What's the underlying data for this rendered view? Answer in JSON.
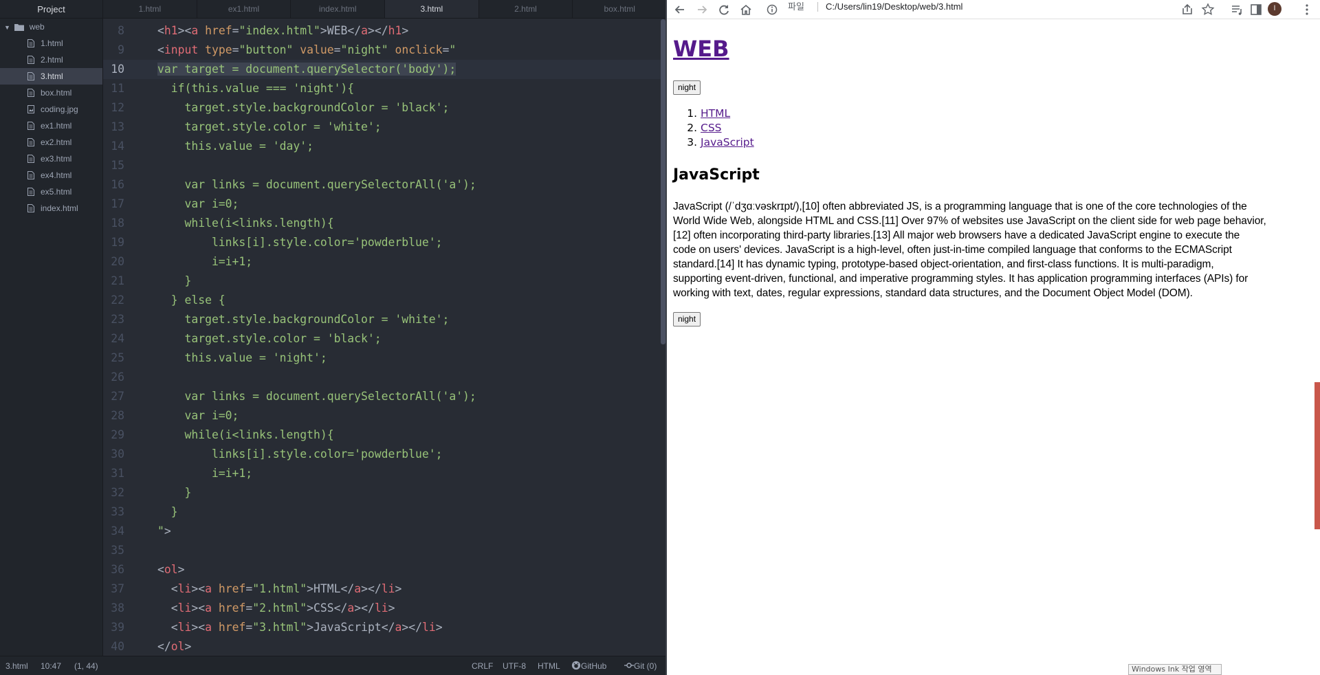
{
  "tree": {
    "header": "Project",
    "root": "web",
    "files": [
      {
        "name": "1.html",
        "icon": "file-text-icon"
      },
      {
        "name": "2.html",
        "icon": "file-text-icon"
      },
      {
        "name": "3.html",
        "icon": "file-text-icon",
        "selected": true
      },
      {
        "name": "box.html",
        "icon": "file-text-icon"
      },
      {
        "name": "coding.jpg",
        "icon": "image-file-icon"
      },
      {
        "name": "ex1.html",
        "icon": "file-text-icon"
      },
      {
        "name": "ex2.html",
        "icon": "file-text-icon"
      },
      {
        "name": "ex3.html",
        "icon": "file-text-icon"
      },
      {
        "name": "ex4.html",
        "icon": "file-text-icon"
      },
      {
        "name": "ex5.html",
        "icon": "file-text-icon"
      },
      {
        "name": "index.html",
        "icon": "file-text-icon"
      }
    ]
  },
  "tabs": [
    {
      "label": "1.html"
    },
    {
      "label": "ex1.html"
    },
    {
      "label": "index.html"
    },
    {
      "label": "3.html",
      "active": true
    },
    {
      "label": "2.html"
    },
    {
      "label": "box.html"
    }
  ],
  "code": {
    "current_line": 10,
    "lines": [
      {
        "n": "8",
        "html": "<span class=\"p\">&lt;</span><span class=\"t\">h1</span><span class=\"p\">&gt;&lt;</span><span class=\"t\">a</span> <span class=\"a\">href</span><span class=\"p\">=</span><span class=\"s\">\"index.html\"</span><span class=\"p\">&gt;WEB&lt;/</span><span class=\"t\">a</span><span class=\"p\">&gt;&lt;/</span><span class=\"t\">h1</span><span class=\"p\">&gt;</span>"
      },
      {
        "n": "9",
        "html": "<span class=\"p\">&lt;</span><span class=\"t\">input</span> <span class=\"a\">type</span><span class=\"p\">=</span><span class=\"s\">\"button\"</span> <span class=\"a\">value</span><span class=\"p\">=</span><span class=\"s\">\"night\"</span> <span class=\"a\">onclick</span><span class=\"p\">=</span><span class=\"s\">\"</span>"
      },
      {
        "n": "10",
        "html": "<span class=\"hl\"><span class=\"s\">var target = document.querySelector('body');</span></span>"
      },
      {
        "n": "11",
        "html": "<span class=\"s\">  if(this.value === 'night'){</span>"
      },
      {
        "n": "12",
        "html": "<span class=\"s\">    target.style.backgroundColor = 'black';</span>"
      },
      {
        "n": "13",
        "html": "<span class=\"s\">    target.style.color = 'white';</span>"
      },
      {
        "n": "14",
        "html": "<span class=\"s\">    this.value = 'day';</span>"
      },
      {
        "n": "15",
        "html": ""
      },
      {
        "n": "16",
        "html": "<span class=\"s\">    var links = document.querySelectorAll('a');</span>"
      },
      {
        "n": "17",
        "html": "<span class=\"s\">    var i=0;</span>"
      },
      {
        "n": "18",
        "html": "<span class=\"s\">    while(i&lt;links.length){</span>"
      },
      {
        "n": "19",
        "html": "<span class=\"s\">        links[i].style.color='powderblue';</span>"
      },
      {
        "n": "20",
        "html": "<span class=\"s\">        i=i+1;</span>"
      },
      {
        "n": "21",
        "html": "<span class=\"s\">    }</span>"
      },
      {
        "n": "22",
        "html": "<span class=\"s\">  } else {</span>"
      },
      {
        "n": "23",
        "html": "<span class=\"s\">    target.style.backgroundColor = 'white';</span>"
      },
      {
        "n": "24",
        "html": "<span class=\"s\">    target.style.color = 'black';</span>"
      },
      {
        "n": "25",
        "html": "<span class=\"s\">    this.value = 'night';</span>"
      },
      {
        "n": "26",
        "html": ""
      },
      {
        "n": "27",
        "html": "<span class=\"s\">    var links = document.querySelectorAll('a');</span>"
      },
      {
        "n": "28",
        "html": "<span class=\"s\">    var i=0;</span>"
      },
      {
        "n": "29",
        "html": "<span class=\"s\">    while(i&lt;links.length){</span>"
      },
      {
        "n": "30",
        "html": "<span class=\"s\">        links[i].style.color='powderblue';</span>"
      },
      {
        "n": "31",
        "html": "<span class=\"s\">        i=i+1;</span>"
      },
      {
        "n": "32",
        "html": "<span class=\"s\">    }</span>"
      },
      {
        "n": "33",
        "html": "<span class=\"s\">  }</span>"
      },
      {
        "n": "34",
        "html": "<span class=\"s\">\"</span><span class=\"p\">&gt;</span>"
      },
      {
        "n": "35",
        "html": ""
      },
      {
        "n": "36",
        "html": "<span class=\"p\">&lt;</span><span class=\"t\">ol</span><span class=\"p\">&gt;</span>"
      },
      {
        "n": "37",
        "html": "<span class=\"p\">  &lt;</span><span class=\"t\">li</span><span class=\"p\">&gt;&lt;</span><span class=\"t\">a</span> <span class=\"a\">href</span><span class=\"p\">=</span><span class=\"s\">\"1.html\"</span><span class=\"p\">&gt;HTML&lt;/</span><span class=\"t\">a</span><span class=\"p\">&gt;&lt;/</span><span class=\"t\">li</span><span class=\"p\">&gt;</span>"
      },
      {
        "n": "38",
        "html": "<span class=\"p\">  &lt;</span><span class=\"t\">li</span><span class=\"p\">&gt;&lt;</span><span class=\"t\">a</span> <span class=\"a\">href</span><span class=\"p\">=</span><span class=\"s\">\"2.html\"</span><span class=\"p\">&gt;CSS&lt;/</span><span class=\"t\">a</span><span class=\"p\">&gt;&lt;/</span><span class=\"t\">li</span><span class=\"p\">&gt;</span>"
      },
      {
        "n": "39",
        "html": "<span class=\"p\">  &lt;</span><span class=\"t\">li</span><span class=\"p\">&gt;&lt;</span><span class=\"t\">a</span> <span class=\"a\">href</span><span class=\"p\">=</span><span class=\"s\">\"3.html\"</span><span class=\"p\">&gt;JavaScript&lt;/</span><span class=\"t\">a</span><span class=\"p\">&gt;&lt;/</span><span class=\"t\">li</span><span class=\"p\">&gt;</span>"
      },
      {
        "n": "40",
        "html": "<span class=\"p\">&lt;/</span><span class=\"t\">ol</span><span class=\"p\">&gt;</span>"
      }
    ]
  },
  "status": {
    "file": "3.html",
    "position": "10:47",
    "selection": "(1, 44)",
    "line_ending": "CRLF",
    "encoding": "UTF-8",
    "grammar": "HTML",
    "github": "GitHub",
    "git": "Git (0)"
  },
  "browser": {
    "url_scheme": "파일",
    "url": "C:/Users/lin19/Desktop/web/3.html",
    "profile_initial": "l"
  },
  "page": {
    "title": "WEB",
    "button_top": "night",
    "list": [
      {
        "num": "1.",
        "label": "HTML"
      },
      {
        "num": "2.",
        "label": "CSS"
      },
      {
        "num": "3.",
        "label": "JavaScript"
      }
    ],
    "heading": "JavaScript",
    "paragraph": "JavaScript (/ˈdʒɑːvəskrɪpt/),[10] often abbreviated JS, is a programming language that is one of the core technologies of the\nWorld Wide Web, alongside HTML and CSS.[11] Over 97% of websites use JavaScript on the client side for web page behavior,\n[12] often incorporating third-party libraries.[13] All major web browsers have a dedicated JavaScript engine to execute the\ncode on users' devices. JavaScript is a high-level, often just-in-time compiled language that conforms to the ECMAScript\nstandard.[14] It has dynamic typing, prototype-based object-orientation, and first-class functions. It is multi-paradigm,\nsupporting event-driven, functional, and imperative programming styles. It has application programming interfaces (APIs) for\nworking with text, dates, regular expressions, standard data structures, and the Document Object Model (DOM).",
    "button_bottom": "night"
  },
  "overlay": {
    "ink_tooltip": "Windows Ink 작업 영역"
  },
  "colors": {
    "editor_bg": "#282c34",
    "sidebar_bg": "#21252b",
    "visited_link": "#551a8b",
    "string": "#98c379",
    "tag": "#e06c75"
  }
}
